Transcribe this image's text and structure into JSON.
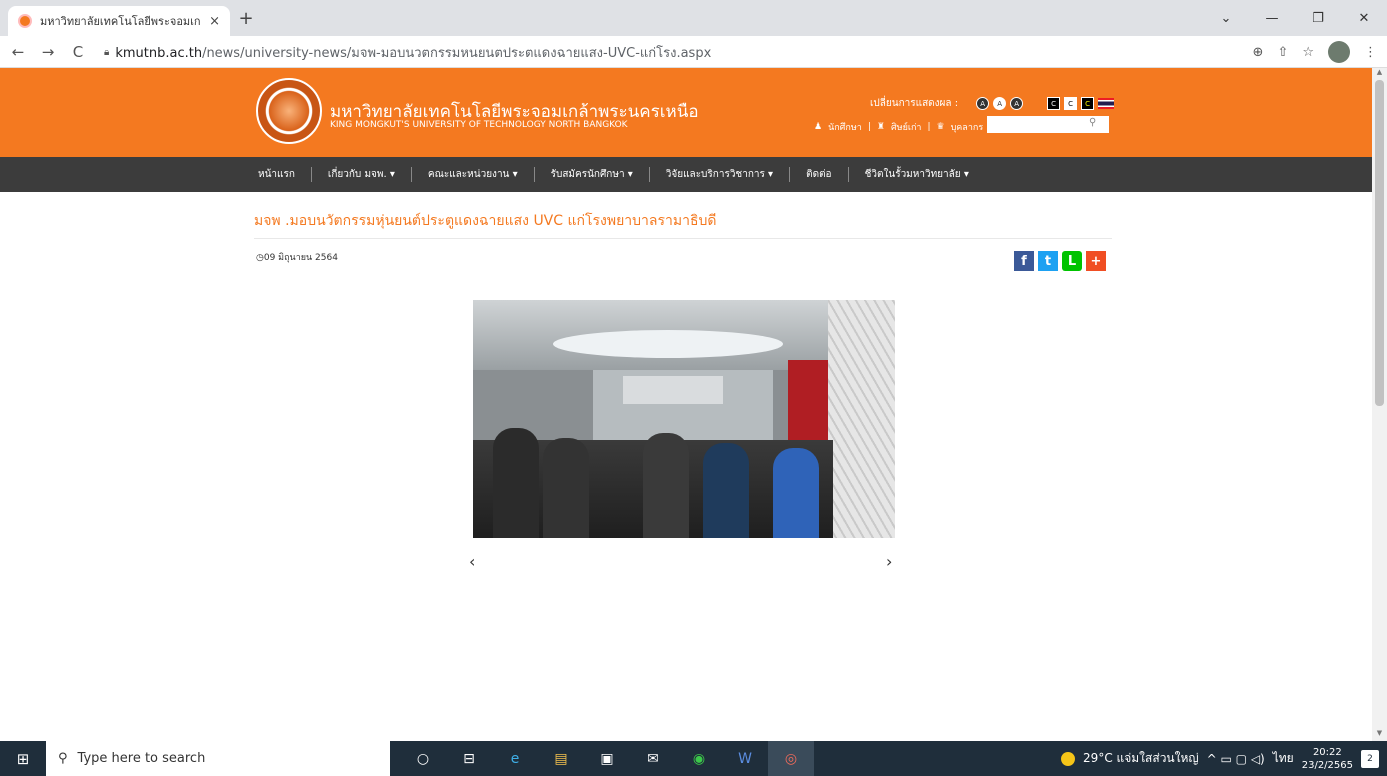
{
  "browser": {
    "tab_title": "มหาวิทยาลัยเทคโนโลยีพระจอมเกล้าพระ",
    "tab_close": "×",
    "new_tab": "+",
    "url_host": "kmutnb.ac.th",
    "url_path": "/news/university-news/มจพ-มอบนวตกรรมหนยนตประตแดงฉายแสง-UVC-แก่โรง.aspx",
    "back": "←",
    "forward": "→",
    "reload": "C",
    "zoom_icon": "⊕",
    "share_icon": "⇧",
    "bookmark_icon": "☆",
    "menu_icon": "⋮",
    "min": "—",
    "restore": "❐",
    "close": "✕",
    "chevron": "⌄"
  },
  "header": {
    "name_th": "มหาวิทยาลัยเทคโนโลยีพระจอมเกล้าพระนครเหนือ",
    "name_en": "KING MONGKUT'S UNIVERSITY OF TECHNOLOGY NORTH BANGKOK",
    "display_label": "เปลี่ยนการแสดงผล :",
    "font_sizes": [
      "A",
      "A",
      "A"
    ],
    "contrast": [
      "C",
      "C",
      "C"
    ],
    "user_links": [
      "นักศึกษา",
      "ศิษย์เก่า",
      "บุคลากร"
    ],
    "search_placeholder": "",
    "search_icon": "⚲"
  },
  "nav": {
    "items": [
      "หน้าแรก",
      "เกี่ยวกับ มจพ.  ▾",
      "คณะและหน่วยงาน  ▾",
      "รับสมัครนักศึกษา  ▾",
      "วิจัยและบริการวิชาการ  ▾",
      "ติดต่อ",
      "ชีวิตในรั้วมหาวิทยาลัย  ▾"
    ]
  },
  "article": {
    "title": "มจพ .มอบนวัตกรรมหุ่นยนต์ประตูแดงฉายแสง UVC แก่โรงพยาบาลรามาธิบดี",
    "date": "09 มิถุนายน 2564",
    "clock_icon": "◷",
    "share": {
      "facebook": "f",
      "twitter": "t",
      "line": "L",
      "more": "+"
    },
    "prev": "‹",
    "next": "›"
  },
  "taskbar": {
    "search_placeholder": "Type here to search",
    "search_icon": "⚲",
    "start_icon": "⊞",
    "apps": [
      "○",
      "⊟",
      "e",
      "▤",
      "▣",
      "✉",
      "◉",
      "W",
      "◎"
    ],
    "weather": "29°C  แจ่มใสส่วนใหญ่",
    "tray_icons": "^  ▭  ▢  ◁)",
    "lang": "ไทย",
    "time": "20:22",
    "date": "23/2/2565",
    "notif": "2"
  },
  "colors": {
    "brand_orange": "#f47920",
    "nav_dark": "#3c3c3c",
    "taskbar": "#1f2e3b"
  }
}
